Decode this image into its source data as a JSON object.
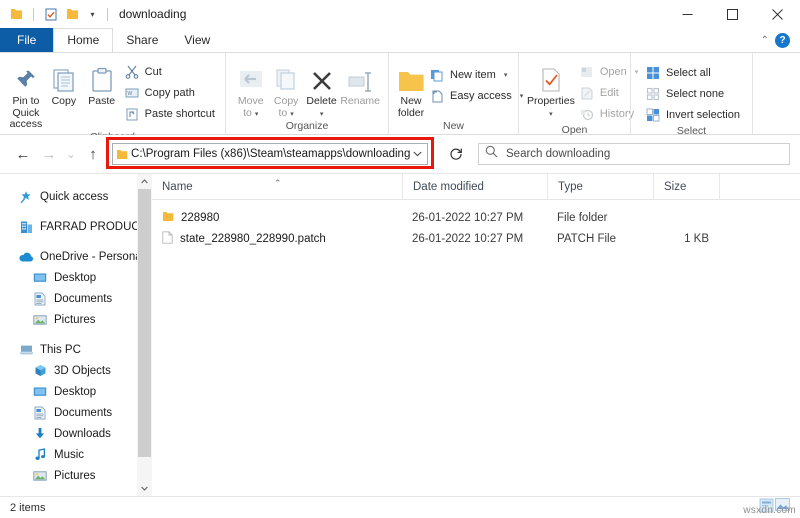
{
  "window": {
    "title": "downloading",
    "quick_access_icons": [
      "folder-icon",
      "properties-icon",
      "new-folder-icon",
      "customize-caret-icon"
    ],
    "controls": {
      "minimize": "minimize-icon",
      "maximize": "maximize-icon",
      "close": "close-icon"
    }
  },
  "tabs": [
    {
      "label": "File",
      "kind": "file"
    },
    {
      "label": "Home",
      "kind": "active"
    },
    {
      "label": "Share",
      "kind": "normal"
    },
    {
      "label": "View",
      "kind": "normal"
    }
  ],
  "ribbon": {
    "collapse_icon": "chevron-up-icon",
    "help_label": "?",
    "groups": [
      {
        "label": "Clipboard",
        "big_buttons": [
          {
            "label": "Pin to Quick\naccess",
            "line1": "Pin to Quick",
            "line2": "access",
            "icon": "pin-icon",
            "disabled": false
          },
          {
            "label": "Copy",
            "line1": "Copy",
            "line2": "",
            "icon": "copy-icon",
            "disabled": false
          },
          {
            "label": "Paste",
            "line1": "Paste",
            "line2": "",
            "icon": "paste-icon",
            "disabled": false
          }
        ],
        "small_buttons": [
          {
            "label": "Cut",
            "icon": "scissors-icon",
            "disabled": false
          },
          {
            "label": "Copy path",
            "icon": "copy-path-icon",
            "disabled": false
          },
          {
            "label": "Paste shortcut",
            "icon": "paste-shortcut-icon",
            "disabled": false
          }
        ]
      },
      {
        "label": "Organize",
        "big_buttons": [
          {
            "line1": "Move",
            "line2": "to",
            "icon": "move-to-icon",
            "disabled": true,
            "caret": true
          },
          {
            "line1": "Copy",
            "line2": "to",
            "icon": "copy-to-icon",
            "disabled": true,
            "caret": true
          },
          {
            "line1": "Delete",
            "line2": "",
            "icon": "delete-icon",
            "disabled": false,
            "caret": true
          },
          {
            "line1": "Rename",
            "line2": "",
            "icon": "rename-icon",
            "disabled": true,
            "caret": false
          }
        ],
        "small_buttons": []
      },
      {
        "label": "New",
        "big_buttons": [
          {
            "line1": "New",
            "line2": "folder",
            "icon": "new-folder-icon",
            "disabled": false
          }
        ],
        "small_buttons": [
          {
            "label": "New item",
            "icon": "new-item-icon",
            "disabled": false,
            "caret": true
          },
          {
            "label": "Easy access",
            "icon": "easy-access-icon",
            "disabled": false,
            "caret": true
          }
        ]
      },
      {
        "label": "Open",
        "big_buttons": [
          {
            "line1": "Properties",
            "line2": "",
            "icon": "properties-icon",
            "disabled": false,
            "caret": true
          }
        ],
        "small_buttons": [
          {
            "label": "Open",
            "icon": "open-icon",
            "disabled": true,
            "caret": true
          },
          {
            "label": "Edit",
            "icon": "edit-icon",
            "disabled": true
          },
          {
            "label": "History",
            "icon": "history-icon",
            "disabled": true
          }
        ]
      },
      {
        "label": "Select",
        "big_buttons": [],
        "small_buttons": [
          {
            "label": "Select all",
            "icon": "select-all-icon",
            "disabled": false
          },
          {
            "label": "Select none",
            "icon": "select-none-icon",
            "disabled": false
          },
          {
            "label": "Invert selection",
            "icon": "invert-selection-icon",
            "disabled": false
          }
        ]
      }
    ]
  },
  "navbar": {
    "back": "back-arrow-icon",
    "forward": "forward-arrow-icon",
    "recent": "recent-locations-caret-icon",
    "up": "up-arrow-icon",
    "address_value": "C:\\Program Files (x86)\\Steam\\steamapps\\downloading",
    "address_dropdown": "chevron-down-icon",
    "refresh": "refresh-icon",
    "highlight_color": "#e8180c",
    "search_placeholder": "Search downloading",
    "search_icon": "search-icon"
  },
  "sidebar": {
    "items": [
      {
        "label": "Quick access",
        "icon": "star-pin-icon",
        "level": 0,
        "gap_after": true
      },
      {
        "label": "FARRAD PRODUCTION",
        "icon": "business-icon",
        "level": 0,
        "gap_after": true
      },
      {
        "label": "OneDrive - Personal",
        "icon": "onedrive-cloud-icon",
        "level": 0,
        "gap_after": false
      },
      {
        "label": "Desktop",
        "icon": "desktop-icon",
        "level": 1,
        "gap_after": false
      },
      {
        "label": "Documents",
        "icon": "documents-icon",
        "level": 1,
        "gap_after": false
      },
      {
        "label": "Pictures",
        "icon": "pictures-icon",
        "level": 1,
        "gap_after": true
      },
      {
        "label": "This PC",
        "icon": "this-pc-icon",
        "level": 0,
        "gap_after": false
      },
      {
        "label": "3D Objects",
        "icon": "3d-objects-icon",
        "level": 1,
        "gap_after": false
      },
      {
        "label": "Desktop",
        "icon": "desktop-icon",
        "level": 1,
        "gap_after": false
      },
      {
        "label": "Documents",
        "icon": "documents-icon",
        "level": 1,
        "gap_after": false
      },
      {
        "label": "Downloads",
        "icon": "downloads-icon",
        "level": 1,
        "gap_after": false
      },
      {
        "label": "Music",
        "icon": "music-icon",
        "level": 1,
        "gap_after": false
      },
      {
        "label": "Pictures",
        "icon": "pictures-icon",
        "level": 1,
        "gap_after": false
      }
    ],
    "scroll_up": "scroll-up-icon",
    "scroll_down": "scroll-down-icon"
  },
  "filelist": {
    "columns": [
      {
        "label": "Name",
        "sorted": "asc"
      },
      {
        "label": "Date modified",
        "sorted": ""
      },
      {
        "label": "Type",
        "sorted": ""
      },
      {
        "label": "Size",
        "sorted": ""
      }
    ],
    "rows": [
      {
        "name": "228980",
        "date": "26-01-2022 10:27 PM",
        "type": "File folder",
        "size": "",
        "icon": "folder-icon"
      },
      {
        "name": "state_228980_228990.patch",
        "date": "26-01-2022 10:27 PM",
        "type": "PATCH File",
        "size": "1 KB",
        "icon": "file-icon"
      }
    ]
  },
  "statusbar": {
    "item_count": "2 items"
  },
  "watermark": {
    "text": "wsxdn.com"
  }
}
